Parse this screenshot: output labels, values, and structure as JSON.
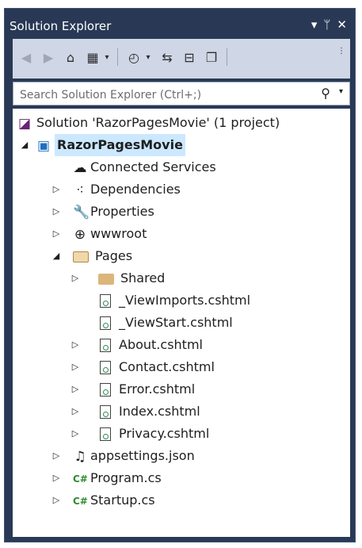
{
  "window": {
    "title": "Solution Explorer",
    "controls": {
      "dropdown": "▾",
      "pin": "ᛘ",
      "close": "✕"
    }
  },
  "toolbar": {
    "back_icon": "back-icon",
    "forward_icon": "forward-icon",
    "home_icon": "home-icon",
    "switch_views_icon": "switch-views-icon",
    "pending_changes_icon": "pending-changes-icon",
    "sync_icon": "sync-with-active-document-icon",
    "collapse_all_icon": "collapse-all-icon",
    "show_all_files_icon": "show-all-files-icon",
    "overflow_icon": "overflow-icon"
  },
  "search": {
    "placeholder": "Search Solution Explorer (Ctrl+;)",
    "value": ""
  },
  "tree": {
    "solution": "Solution 'RazorPagesMovie' (1 project)",
    "project": "RazorPagesMovie",
    "items": {
      "connected_services": "Connected Services",
      "dependencies": "Dependencies",
      "properties": "Properties",
      "wwwroot": "wwwroot",
      "pages": "Pages",
      "shared": "Shared",
      "viewimports": "_ViewImports.cshtml",
      "viewstart": "_ViewStart.cshtml",
      "about": "About.cshtml",
      "contact": "Contact.cshtml",
      "error": "Error.cshtml",
      "index": "Index.cshtml",
      "privacy": "Privacy.cshtml",
      "appsettings": "appsettings.json",
      "program": "Program.cs",
      "startup": "Startup.cs"
    },
    "csharp_badge": "C#"
  },
  "colors": {
    "window_chrome": "#293955",
    "toolbar_bg": "#cfd6e5",
    "selection": "#cce8ff"
  }
}
